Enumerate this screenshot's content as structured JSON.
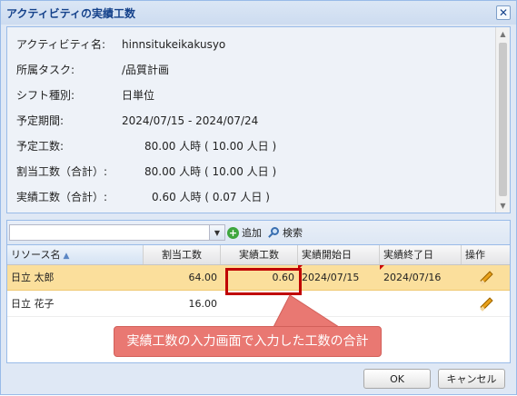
{
  "window": {
    "title": "アクティビティの実績工数"
  },
  "info": [
    {
      "label": "アクティビティ名:",
      "value": "hinnsitukeikakusyo"
    },
    {
      "label": "所属タスク:",
      "value": "/品質計画"
    },
    {
      "label": "シフト種別:",
      "value": "日単位"
    },
    {
      "label": "予定期間:",
      "value": "2024/07/15 - 2024/07/24"
    },
    {
      "label": "予定工数:",
      "value": "80.00 人時 ( 10.00 人日 )"
    },
    {
      "label": "割当工数（合計）:",
      "value": "80.00 人時 ( 10.00 人日 )"
    },
    {
      "label": "実績工数（合計）:",
      "value": "0.60 人時 ( 0.07 人日 )"
    }
  ],
  "toolbar": {
    "combo_value": "",
    "add_label": "追加",
    "search_label": "検索"
  },
  "grid": {
    "columns": [
      "リソース名",
      "割当工数",
      "実績工数",
      "実績開始日",
      "実績終了日",
      "操作"
    ],
    "rows": [
      {
        "name": "日立 太郎",
        "assigned": "64.00",
        "actual": "0.60",
        "start": "2024/07/15",
        "end": "2024/07/16",
        "selected": true
      },
      {
        "name": "日立 花子",
        "assigned": "16.00",
        "actual": "",
        "start": "",
        "end": "",
        "selected": false
      }
    ]
  },
  "callout": {
    "text": "実績工数の入力画面で入力した工数の合計"
  },
  "buttons": {
    "ok": "OK",
    "cancel": "キャンセル"
  },
  "colors": {
    "accent_title": "#15428b",
    "selected_row": "#fbdf9c",
    "highlight": "#c00000",
    "callout": "#e97872"
  }
}
